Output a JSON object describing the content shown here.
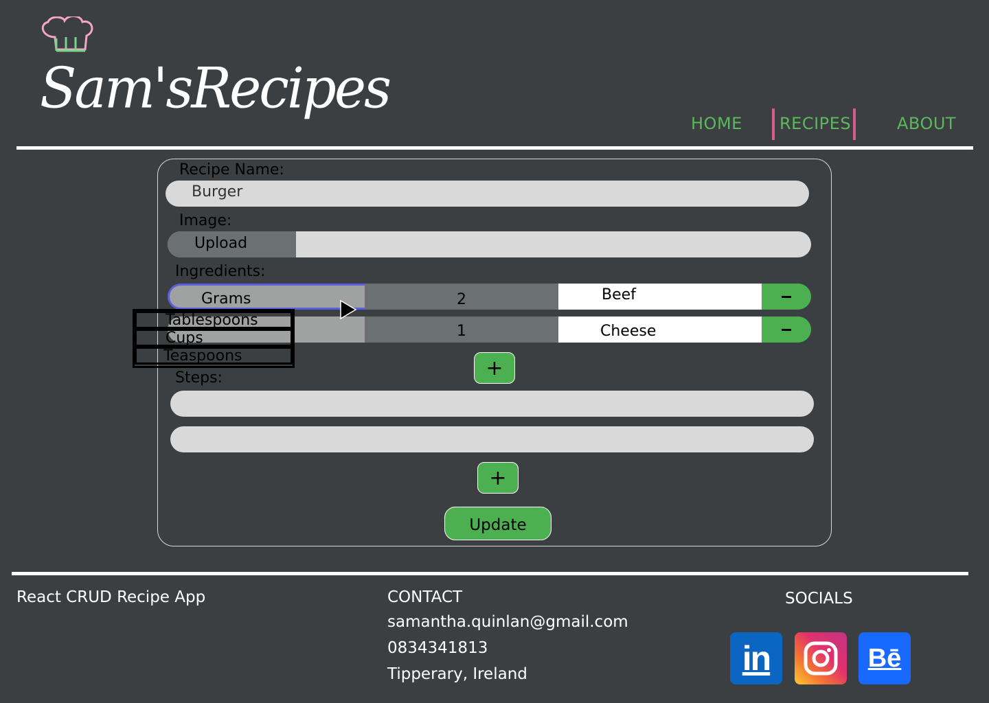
{
  "brand": {
    "logo_text": "Sam'sRecipes"
  },
  "nav": {
    "home": "HOME",
    "recipes": "RECIPES",
    "about": "ABOUT"
  },
  "form": {
    "recipe_name_label": "Recipe Name:",
    "recipe_name_value": "Burger",
    "image_label": "Image:",
    "upload_label": "Upload",
    "ingredients_label": "Ingredients:",
    "ingredients": [
      {
        "unit": "Grams",
        "quantity": "2",
        "name": "Beef"
      },
      {
        "unit": "",
        "quantity": "1",
        "name": "Cheese"
      }
    ],
    "unit_options": [
      "Tablespoons",
      "Cups",
      "Teaspoons"
    ],
    "add_ingredient_label": "+",
    "steps_label": "Steps:",
    "steps": [
      "",
      ""
    ],
    "add_step_label": "+",
    "update_label": "Update"
  },
  "footer": {
    "app_name": "React CRUD Recipe App",
    "contact_heading": "CONTACT",
    "email": "samantha.quinlan@gmail.com",
    "phone": "0834341813",
    "location": "Tipperary, Ireland",
    "socials_heading": "SOCIALS",
    "socials": [
      {
        "icon": "linkedin-icon",
        "label": "in",
        "color": "#0a66c2"
      },
      {
        "icon": "instagram-icon",
        "label": "",
        "color": "#e1306c"
      },
      {
        "icon": "behance-icon",
        "label": "Bē",
        "color": "#1769ff"
      }
    ]
  },
  "colors": {
    "background": "#3c3f41",
    "accent_green": "#4caf50",
    "nav_green": "#5cb85c",
    "nav_pink": "#d75b8d",
    "focus_blue": "#5b60e0"
  }
}
